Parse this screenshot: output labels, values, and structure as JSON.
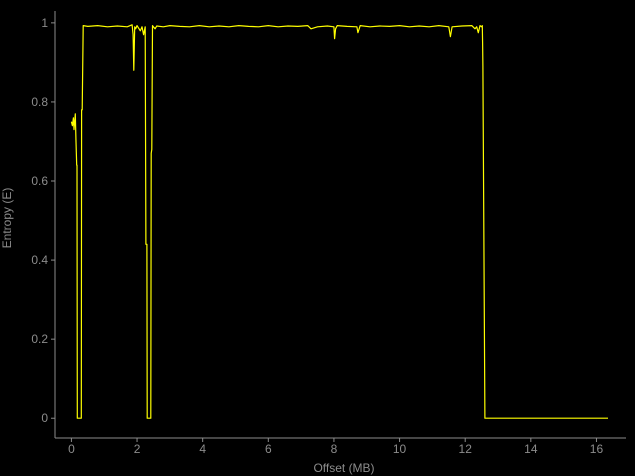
{
  "chart_data": {
    "type": "line",
    "title": "",
    "xlabel": "Offset (MB)",
    "ylabel": "Entropy (E)",
    "xlim": [
      -0.5,
      16.9
    ],
    "ylim": [
      -0.05,
      1.03
    ],
    "xticks": [
      0,
      2,
      4,
      6,
      8,
      10,
      12,
      14,
      16
    ],
    "yticks": [
      0,
      0.2,
      0.4,
      0.6,
      0.8,
      1
    ],
    "ytick_labels": [
      "0",
      "0.2",
      "0.4",
      "0.6",
      "0.8",
      "1"
    ],
    "grid": false,
    "line_color": "#ffff00",
    "axis_color": "#8c8c8c",
    "background": "#000000",
    "series": [
      {
        "x": [
          0.0,
          0.03,
          0.06,
          0.08,
          0.1,
          0.12,
          0.14,
          0.16,
          0.17,
          0.18,
          0.18,
          0.2,
          0.24,
          0.28,
          0.3,
          0.31,
          0.33,
          0.36,
          0.5,
          0.8,
          1.1,
          1.4,
          1.7,
          1.85,
          1.88,
          1.9,
          1.93,
          1.96,
          2.0,
          2.1,
          2.15,
          2.2,
          2.25,
          2.27,
          2.3,
          2.31,
          2.31,
          2.4,
          2.42,
          2.43,
          2.45,
          2.47,
          2.5,
          2.55,
          2.6,
          2.8,
          3.0,
          3.3,
          3.6,
          3.9,
          4.2,
          4.5,
          4.8,
          5.1,
          5.4,
          5.7,
          6.0,
          6.3,
          6.6,
          6.9,
          7.2,
          7.3,
          7.5,
          7.8,
          8.0,
          8.02,
          8.05,
          8.1,
          8.4,
          8.7,
          8.73,
          8.8,
          9.1,
          9.4,
          9.7,
          10.0,
          10.3,
          10.6,
          10.9,
          11.2,
          11.5,
          11.55,
          11.6,
          11.9,
          12.2,
          12.3,
          12.35,
          12.4,
          12.45,
          12.5,
          12.52,
          12.53,
          12.54,
          12.6,
          12.65,
          12.7,
          13.5,
          14.5,
          15.5,
          16.35
        ],
        "y": [
          0.75,
          0.74,
          0.76,
          0.73,
          0.75,
          0.77,
          0.7,
          0.64,
          0.64,
          0.0,
          0.0,
          0.0,
          0.0,
          0.0,
          0.0,
          0.78,
          0.78,
          0.993,
          0.991,
          0.993,
          0.99,
          0.992,
          0.99,
          0.995,
          0.97,
          0.88,
          0.99,
          0.985,
          0.993,
          0.98,
          0.99,
          0.97,
          0.99,
          0.44,
          0.44,
          0.0,
          0.0,
          0.0,
          0.0,
          0.67,
          0.68,
          0.993,
          0.99,
          0.985,
          0.992,
          0.99,
          0.993,
          0.991,
          0.99,
          0.993,
          0.99,
          0.992,
          0.99,
          0.993,
          0.991,
          0.99,
          0.993,
          0.99,
          0.992,
          0.991,
          0.993,
          0.985,
          0.99,
          0.992,
          0.99,
          0.96,
          0.985,
          0.993,
          0.991,
          0.99,
          0.975,
          0.993,
          0.99,
          0.992,
          0.991,
          0.993,
          0.99,
          0.992,
          0.99,
          0.993,
          0.99,
          0.965,
          0.99,
          0.992,
          0.993,
          0.985,
          0.99,
          0.975,
          0.993,
          0.99,
          0.993,
          0.95,
          0.89,
          0.0,
          0.0,
          0.0,
          0.0,
          0.0,
          0.0,
          0.0
        ]
      }
    ]
  }
}
